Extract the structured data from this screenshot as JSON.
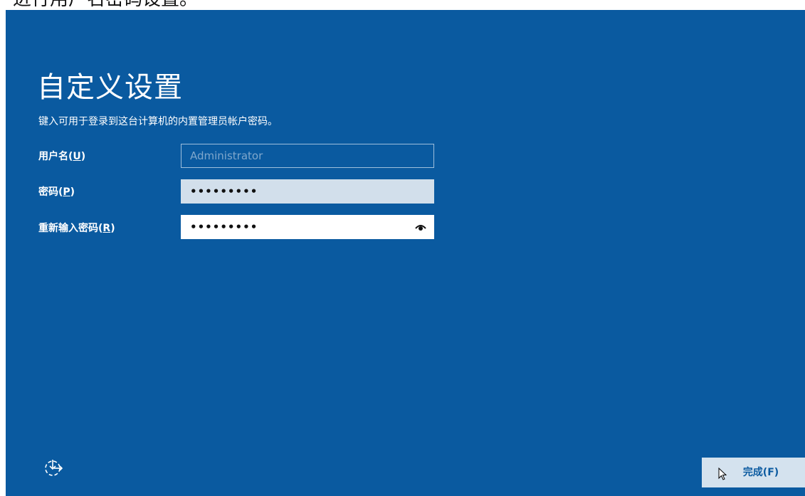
{
  "top_caption": "进行用户名密码设置。",
  "page": {
    "title": "自定义设置",
    "subtitle": "键入可用于登录到这台计算机的内置管理员帐户密码。"
  },
  "form": {
    "username": {
      "label_prefix": "用户名(",
      "accesskey": "U",
      "label_suffix": ")",
      "placeholder": "Administrator"
    },
    "password": {
      "label_prefix": "密码(",
      "accesskey": "P",
      "label_suffix": ")",
      "value_masked": "•••••••••"
    },
    "confirm_password": {
      "label_prefix": "重新输入密码(",
      "accesskey": "R",
      "label_suffix": ")",
      "value_masked": "•••••••••"
    }
  },
  "footer": {
    "finish_label": "完成(F)"
  },
  "icons": {
    "accessibility": "accessibility-icon",
    "reveal_password": "eye-icon",
    "cursor": "mouse-cursor-icon"
  },
  "colors": {
    "background": "#0a5aa0",
    "button_bg": "#d4e2ee",
    "text": "#ffffff"
  }
}
